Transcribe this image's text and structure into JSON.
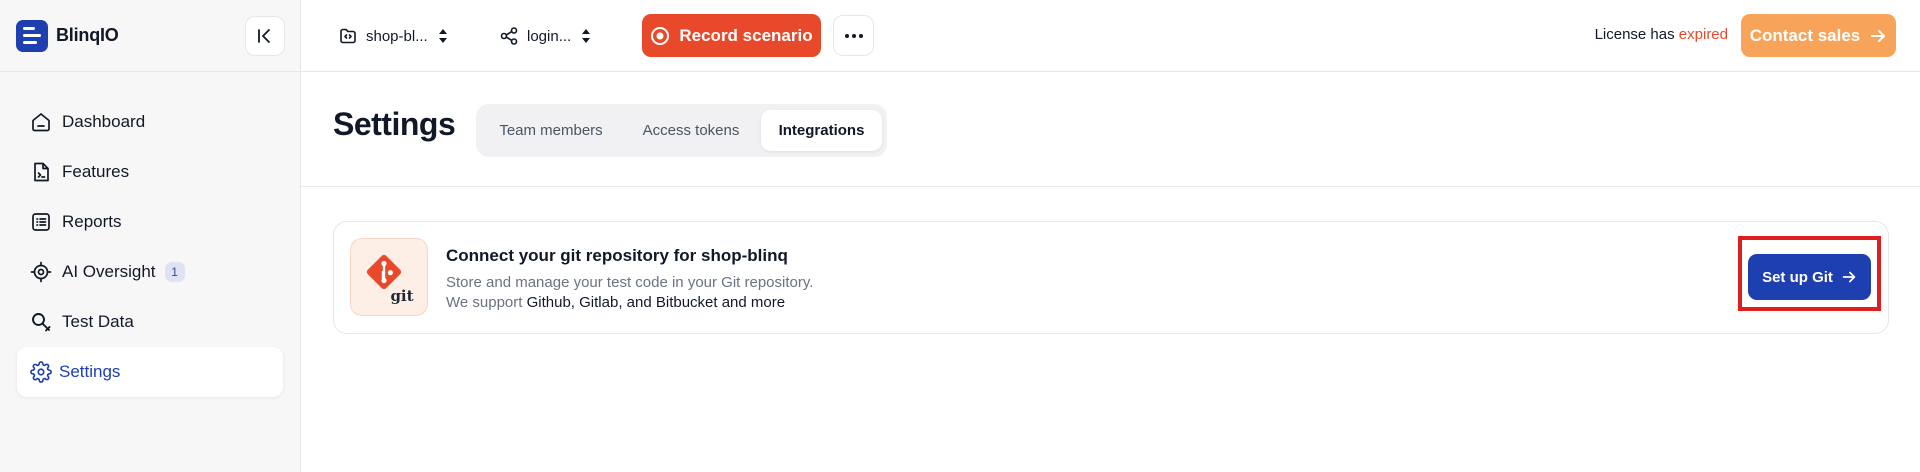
{
  "brand": {
    "name": "BlinqIO"
  },
  "sidebar": {
    "items": [
      {
        "label": "Dashboard",
        "icon": "home-icon"
      },
      {
        "label": "Features",
        "icon": "feature-file-icon"
      },
      {
        "label": "Reports",
        "icon": "list-icon"
      },
      {
        "label": "AI Oversight",
        "icon": "ai-chip-icon",
        "badge": "1"
      },
      {
        "label": "Test Data",
        "icon": "data-search-icon"
      },
      {
        "label": "Settings",
        "icon": "gear-icon",
        "active": true
      }
    ]
  },
  "topbar": {
    "project": "shop-bl...",
    "scenario": "login...",
    "record_label": "Record scenario",
    "license_prefix": "License has",
    "license_status": "expired",
    "contact_label": "Contact sales"
  },
  "settings": {
    "title": "Settings",
    "tabs": [
      {
        "label": "Team members"
      },
      {
        "label": "Access tokens"
      },
      {
        "label": "Integrations",
        "active": true
      }
    ]
  },
  "git_card": {
    "logo_text": "git",
    "title": "Connect your git repository for shop-blinq",
    "desc_line1": "Store and manage your test code in your Git repository.",
    "desc_line2_prefix": "We support ",
    "desc_line2_strong": "Github, Gitlab, and Bitbucket and more",
    "button_label": "Set up Git"
  },
  "colors": {
    "brand_blue": "#1e3faf",
    "record_red": "#e8492b",
    "contact_orange": "#f7a35a",
    "highlight_red": "#e01e1e"
  }
}
